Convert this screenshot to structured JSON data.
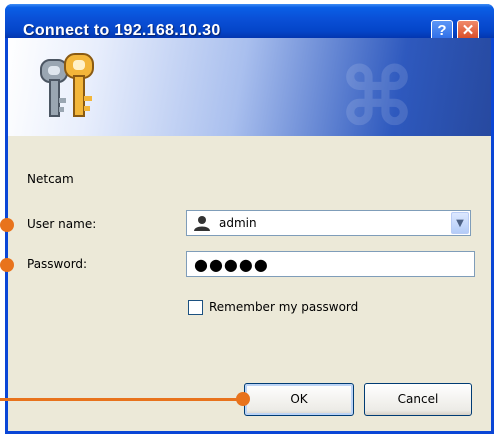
{
  "window": {
    "title": "Connect to 192.168.10.30",
    "help_glyph": "?",
    "close_glyph": "✕"
  },
  "form": {
    "realm": "Netcam",
    "user_label": "User name:",
    "user_value": "admin",
    "password_label": "Password:",
    "password_value": "●●●●●",
    "remember_label": "Remember my password",
    "remember_checked": false
  },
  "buttons": {
    "ok": "OK",
    "cancel": "Cancel"
  },
  "icons": {
    "banner": "keys-icon",
    "user": "user-icon",
    "dropdown": "chevron-down-icon"
  },
  "colors": {
    "titlebar": "#0a4fd6",
    "callout": "#e8731c",
    "dialog_bg": "#ece9d8"
  }
}
